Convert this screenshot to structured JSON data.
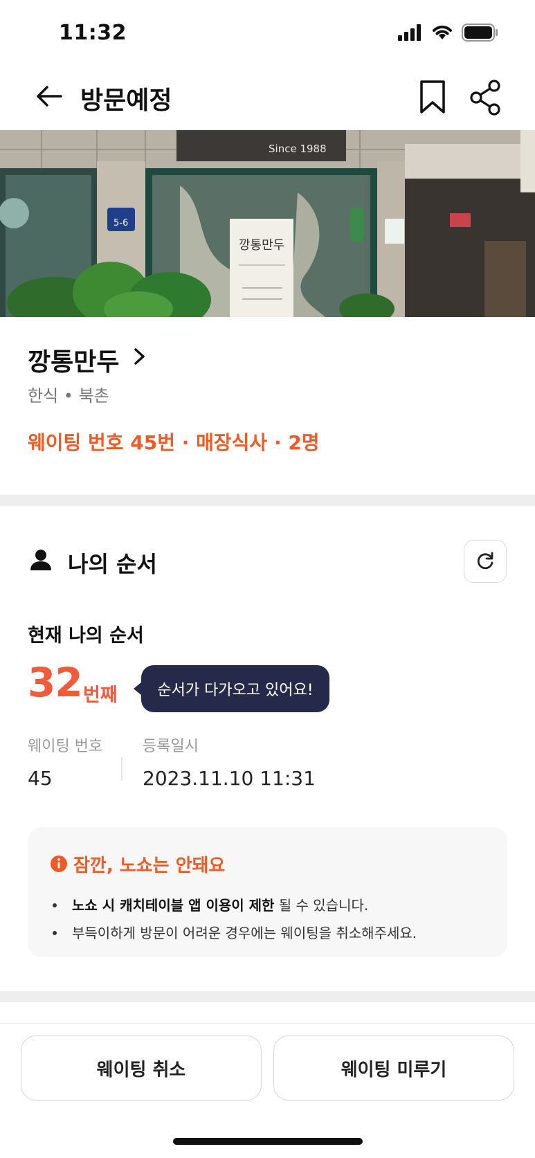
{
  "status_bar": {
    "time": "11:32"
  },
  "header": {
    "title": "방문예정"
  },
  "hero": {
    "sign_text": "Since 1988",
    "store_sign": "깡통만두",
    "address_plate": "5-6"
  },
  "store": {
    "name": "깡통만두",
    "meta": "한식 • 북촌",
    "waiting_summary": "웨이팅 번호 45번 · 매장식사 · 2명"
  },
  "my_order": {
    "section_title": "나의 순서",
    "current_label": "현재 나의 순서",
    "current_number": "32",
    "current_suffix": "번째",
    "tooltip": "순서가 다가오고 있어요!",
    "waiting_number_label": "웨이팅 번호",
    "waiting_number": "45",
    "registered_label": "등록일시",
    "registered_at": "2023.11.10 11:31"
  },
  "warning": {
    "title": "잠깐, 노쇼는 안돼요",
    "line1_strong": "노쇼 시 캐치테이블 앱 이용이 제한",
    "line1_rest": " 될 수 있습니다.",
    "line2": "부득이하게 방문이 어려운 경우에는 웨이팅을 취소해주세요."
  },
  "actions": {
    "cancel_label": "웨이팅 취소",
    "postpone_label": "웨이팅 미루기"
  },
  "colors": {
    "accent": "#f15a24",
    "tooltip_bg": "#25294a",
    "divider": "#eeeeee"
  }
}
